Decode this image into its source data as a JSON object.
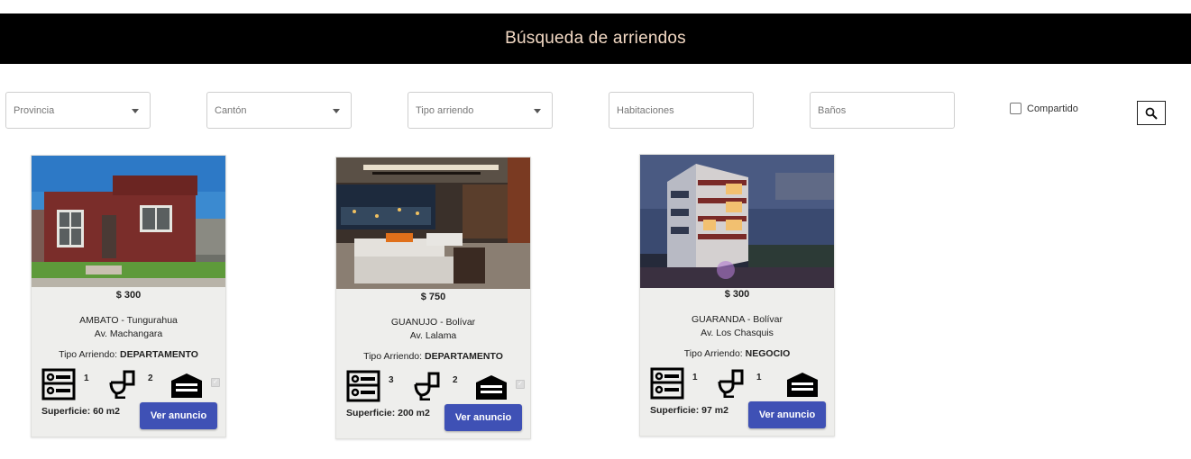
{
  "header": {
    "title": "Búsqueda de arriendos"
  },
  "filters": {
    "provincia": "Provincia",
    "canton": "Cantón",
    "tipo_arriendo": "Tipo arriendo",
    "habitaciones": "Habitaciones",
    "banos": "Baños",
    "compartido_label": "Compartido",
    "search_icon": "search-icon"
  },
  "colors": {
    "header_bg": "#000000",
    "header_text": "#f3d9c4",
    "button": "#3f51b5",
    "card_bg": "#eeeeec"
  },
  "listings": [
    {
      "price": "$ 300",
      "city": "AMBATO - Tungurahua",
      "address": "Av. Machangara",
      "tipo_label": "Tipo Arriendo:",
      "tipo_value": "DEPARTAMENTO",
      "bedrooms": "1",
      "bathrooms": "2",
      "surface": "Superficie: 60 m2",
      "button": "Ver anuncio"
    },
    {
      "price": "$ 750",
      "city": "GUANUJO - Bolívar",
      "address": "Av. Lalama",
      "tipo_label": "Tipo Arriendo:",
      "tipo_value": "DEPARTAMENTO",
      "bedrooms": "3",
      "bathrooms": "2",
      "surface": "Superficie: 200 m2",
      "button": "Ver anuncio"
    },
    {
      "price": "$ 300",
      "city": "GUARANDA - Bolívar",
      "address": "Av. Los Chasquis",
      "tipo_label": "Tipo Arriendo:",
      "tipo_value": "NEGOCIO",
      "bedrooms": "1",
      "bathrooms": "1",
      "surface": "Superficie: 97 m2",
      "button": "Ver anuncio"
    }
  ]
}
